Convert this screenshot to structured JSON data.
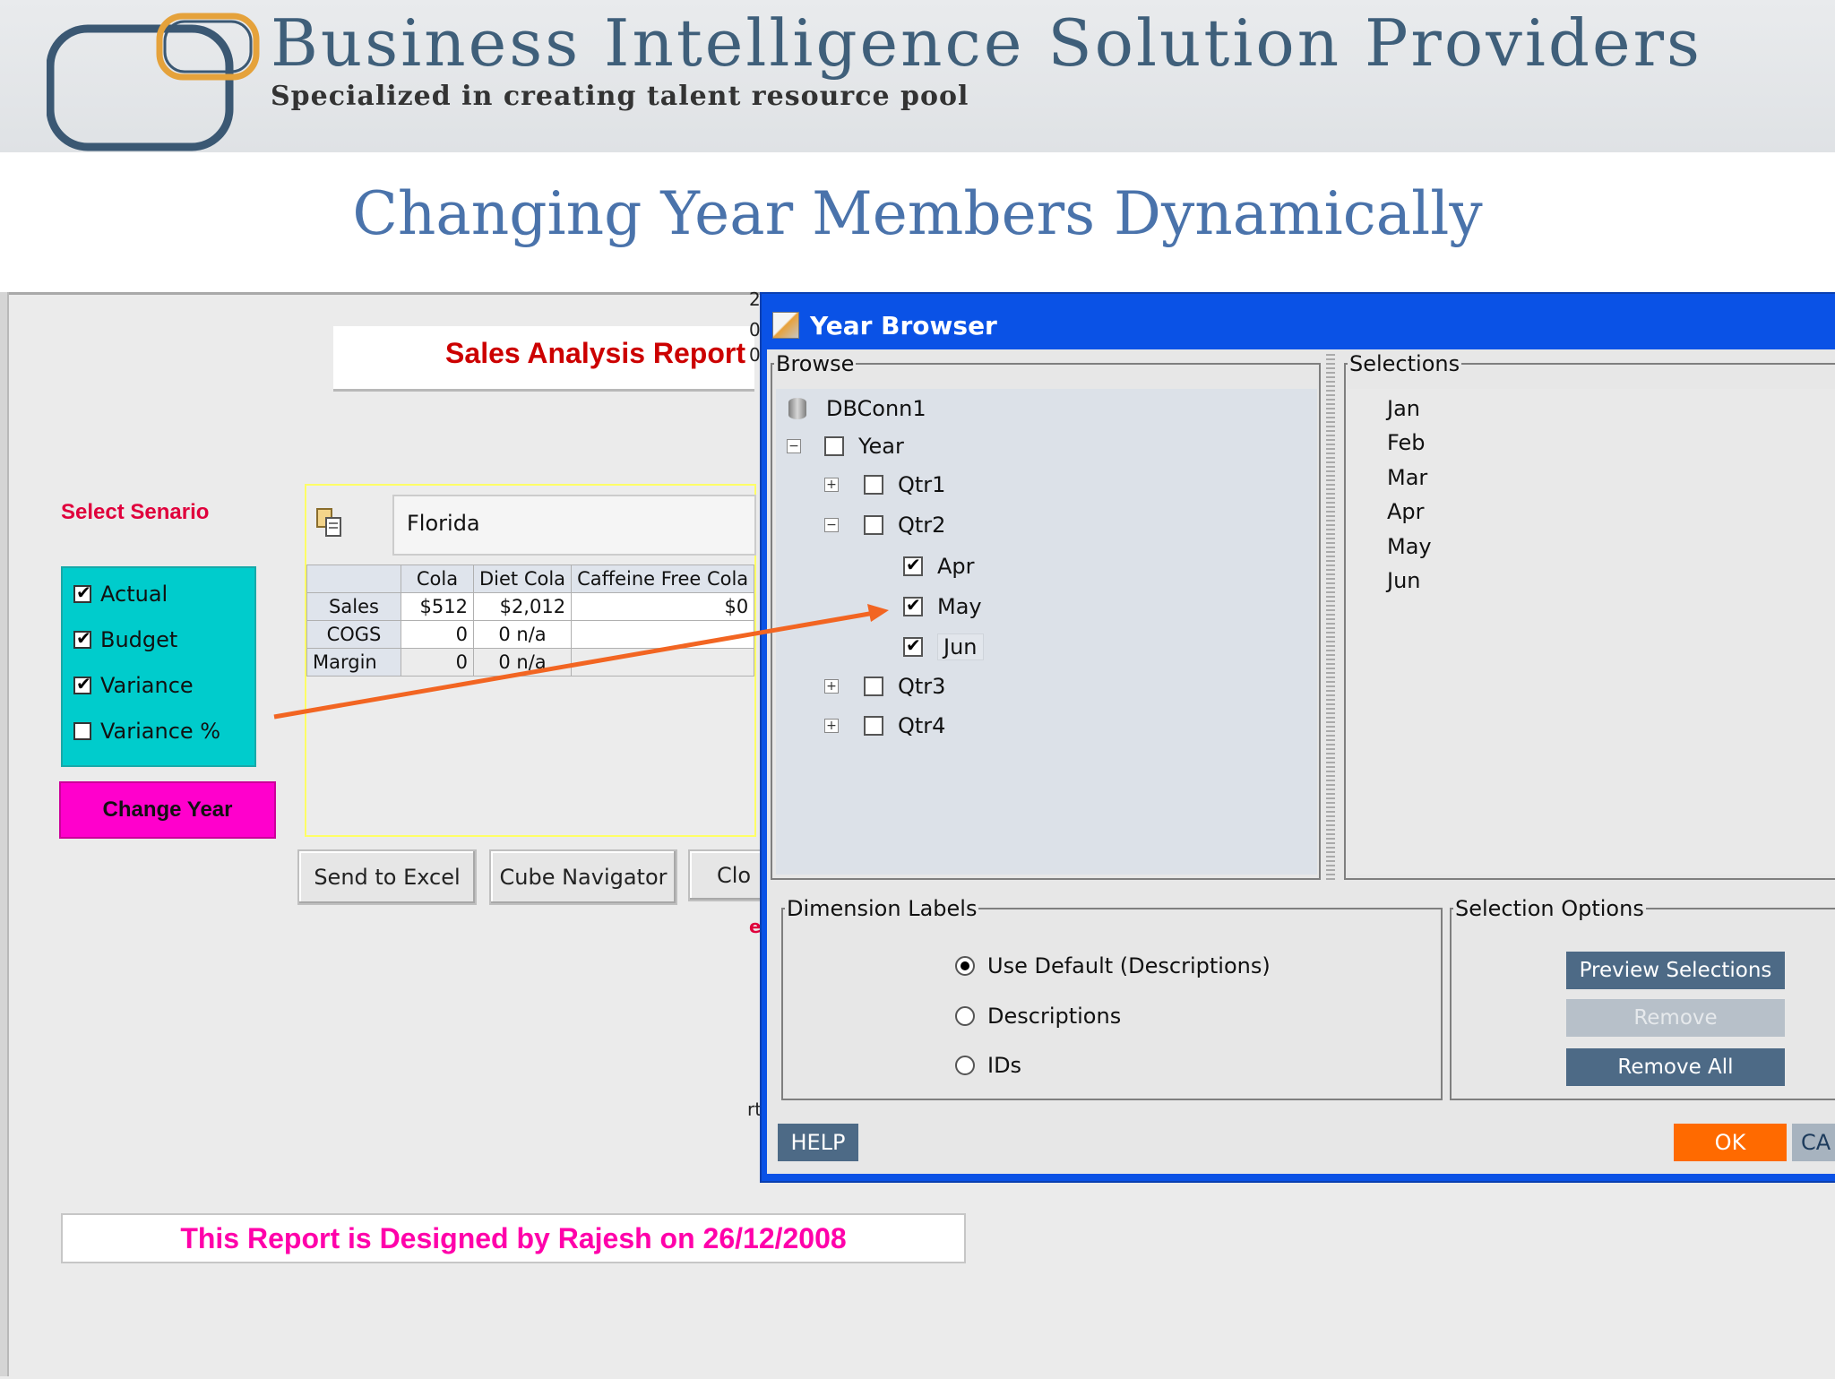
{
  "banner": {
    "company": "Business Intelligence Solution Providers",
    "tagline": "Specialized in creating talent resource pool"
  },
  "slide": {
    "title": "Changing Year Members Dynamically"
  },
  "report": {
    "title": "Sales Analysis Report",
    "scenario_label": "Select Senario",
    "scenarios": [
      {
        "label": "Actual",
        "checked": true
      },
      {
        "label": "Budget",
        "checked": true
      },
      {
        "label": "Variance",
        "checked": true
      },
      {
        "label": "Variance %",
        "checked": false
      }
    ],
    "change_year_label": "Change Year",
    "region": "Florida",
    "grid": {
      "columns": [
        "Cola",
        "Diet Cola",
        "Caffeine Free Cola"
      ],
      "rows": [
        {
          "label": "Sales",
          "values": [
            "$512",
            "$2,012",
            "$0"
          ]
        },
        {
          "label": "COGS",
          "values": [
            "0",
            "0 n/a",
            ""
          ]
        },
        {
          "label": "Margin",
          "values": [
            "0",
            "0 n/a",
            ""
          ]
        }
      ]
    },
    "buttons": {
      "send_to_excel": "Send to Excel",
      "cube_navigator": "Cube Navigator",
      "close_partial": "Clo"
    },
    "designer_note": "This Report is Designed by Rajesh on 26/12/2008",
    "fragments": [
      "2",
      "0",
      "0",
      "rt",
      "e"
    ]
  },
  "dialog": {
    "title": "Year Browser",
    "browse_label": "Browse",
    "selections_label": "Selections",
    "tree": {
      "root": "DBConn1",
      "dimension": "Year",
      "qtr1": "Qtr1",
      "qtr2": "Qtr2",
      "apr": "Apr",
      "may": "May",
      "jun": "Jun",
      "qtr3": "Qtr3",
      "qtr4": "Qtr4"
    },
    "selections": [
      "Jan",
      "Feb",
      "Mar",
      "Apr",
      "May",
      "Jun"
    ],
    "dimension_labels": {
      "legend": "Dimension Labels",
      "options": [
        "Use Default (Descriptions)",
        "Descriptions",
        "IDs"
      ],
      "selected": "Use Default (Descriptions)"
    },
    "selection_options": {
      "legend": "Selection Options",
      "preview": "Preview Selections",
      "remove": "Remove",
      "remove_all": "Remove All"
    },
    "help_label": "HELP",
    "ok_label": "OK",
    "cancel_partial": "CA"
  },
  "colors": {
    "slide_title": "#4a73ab",
    "report_title": "#cc0000",
    "scenario_bg": "#00cccc",
    "change_year_bg": "#ff00cc",
    "dialog_titlebar": "#0a52e6",
    "arrow": "#f26522",
    "ok_button": "#ff6a00"
  }
}
